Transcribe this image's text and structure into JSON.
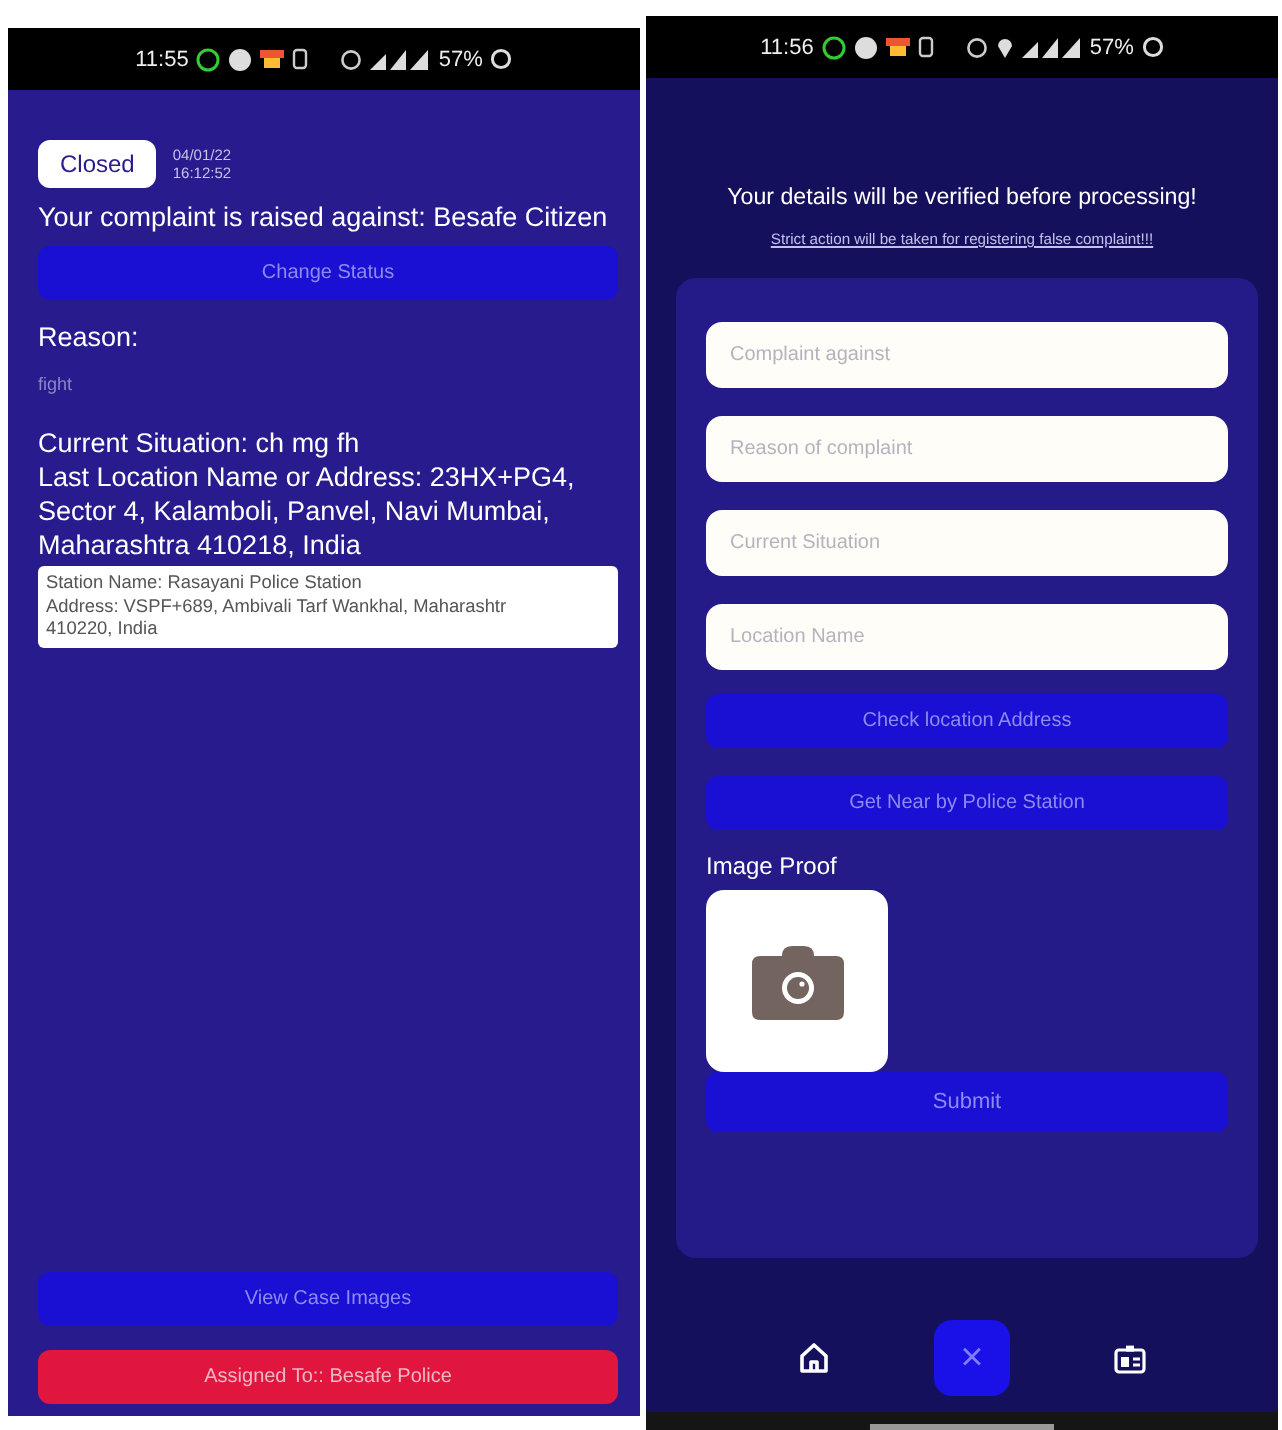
{
  "left_screen": {
    "status_bar": {
      "time": "11:55",
      "battery": "57%"
    },
    "status_badge": "Closed",
    "date": "04/01/22",
    "time": "16:12:52",
    "complaint_against": "Your complaint is raised against: Besafe Citizen",
    "change_status_button": "Change Status",
    "reason_label": "Reason:",
    "reason": "fight",
    "current_situation": "Current Situation: ch mg fh",
    "last_location": "Last Location Name or Address: 23HX+PG4, Sector 4, Kalamboli, Panvel, Navi Mumbai, Maharashtra 410218, India",
    "station_box": {
      "name": "Station Name: Rasayani Police Station",
      "address_line_1": "Address: VSPF+689, Ambivali Tarf Wankhal, Maharashtr",
      "address_line_2": "410220, India"
    },
    "view_images_button": "View Case Images",
    "assigned_button": "Assigned To:: Besafe Police"
  },
  "right_screen": {
    "status_bar": {
      "time": "11:56",
      "battery": "57%"
    },
    "heading": "Your details will be verified before processing!",
    "warning_link": "Strict action will be taken for registering false complaint!!!",
    "fields": [
      {
        "placeholder": "Complaint against"
      },
      {
        "placeholder": "Reason of complaint"
      },
      {
        "placeholder": "Current Situation"
      },
      {
        "placeholder": "Location Name"
      }
    ],
    "buttons": [
      "Check location Address",
      "Get Near by Police Station"
    ],
    "image_proof_label": "Image Proof",
    "submit_button": "Submit",
    "fab": "×"
  }
}
